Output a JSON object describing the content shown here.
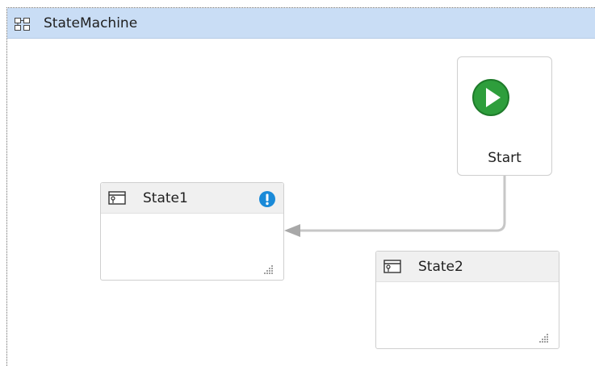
{
  "container": {
    "title": "StateMachine",
    "icon": "state-machine-icon"
  },
  "start_node": {
    "label": "Start",
    "icon": "play-icon",
    "icon_color": "#2e9e3c"
  },
  "states": [
    {
      "label": "State1",
      "icon": "state-icon",
      "has_warning": true,
      "warning_icon": "exclamation-icon",
      "warning_color": "#1a8ad8"
    },
    {
      "label": "State2",
      "icon": "state-icon",
      "has_warning": false
    }
  ],
  "transition": {
    "from": "Start",
    "to": "State1",
    "color": "#bfbfbf"
  },
  "colors": {
    "header_bg": "#c9ddf5",
    "state_header_bg": "#f0f0f0"
  }
}
